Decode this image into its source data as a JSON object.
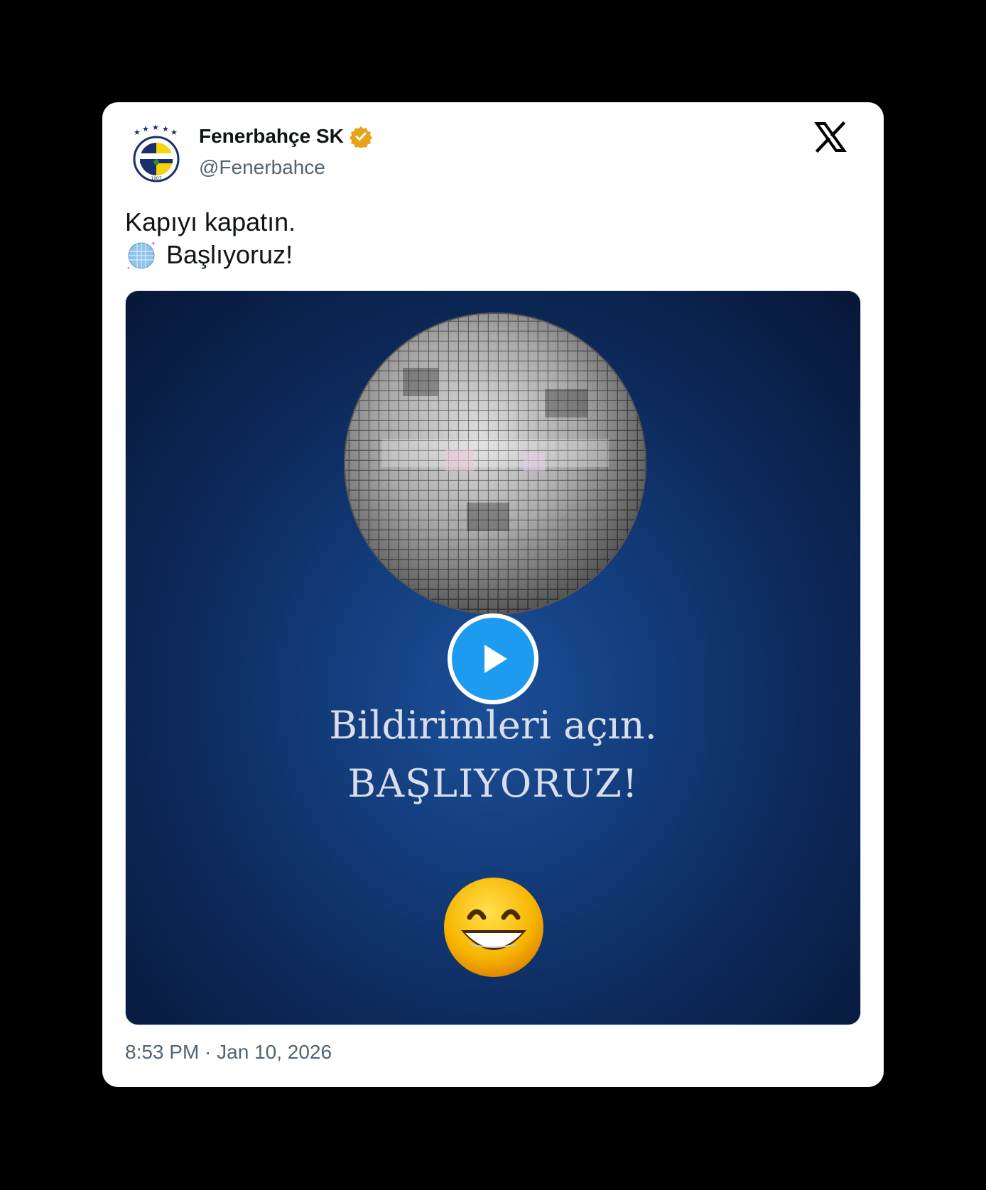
{
  "account": {
    "display_name": "Fenerbahçe SK",
    "handle": "@Fenerbahce",
    "verified_badge": "gold-verified-icon",
    "logo_stars": 5,
    "logo_text": "FENERBAHÇE SPOR KULÜBÜ",
    "logo_year": "1907"
  },
  "platform_icon": "x-logo-icon",
  "tweet": {
    "line1": "Kapıyı kapatın.",
    "line2_emoji": "mirror-ball-icon",
    "line2_text": "Başlıyoruz!"
  },
  "video": {
    "caption_line1": "Bildirimleri açın.",
    "caption_line2": "BAŞLIYORUZ!",
    "play_icon": "play-icon",
    "emoji": "grinning-face-icon"
  },
  "timestamp": "8:53 PM · Jan 10, 2026",
  "colors": {
    "accent": "#1d9bf0",
    "verified": "#e8a317",
    "text": "#0f1419",
    "muted": "#536471",
    "video_bg": "#133d7d"
  }
}
